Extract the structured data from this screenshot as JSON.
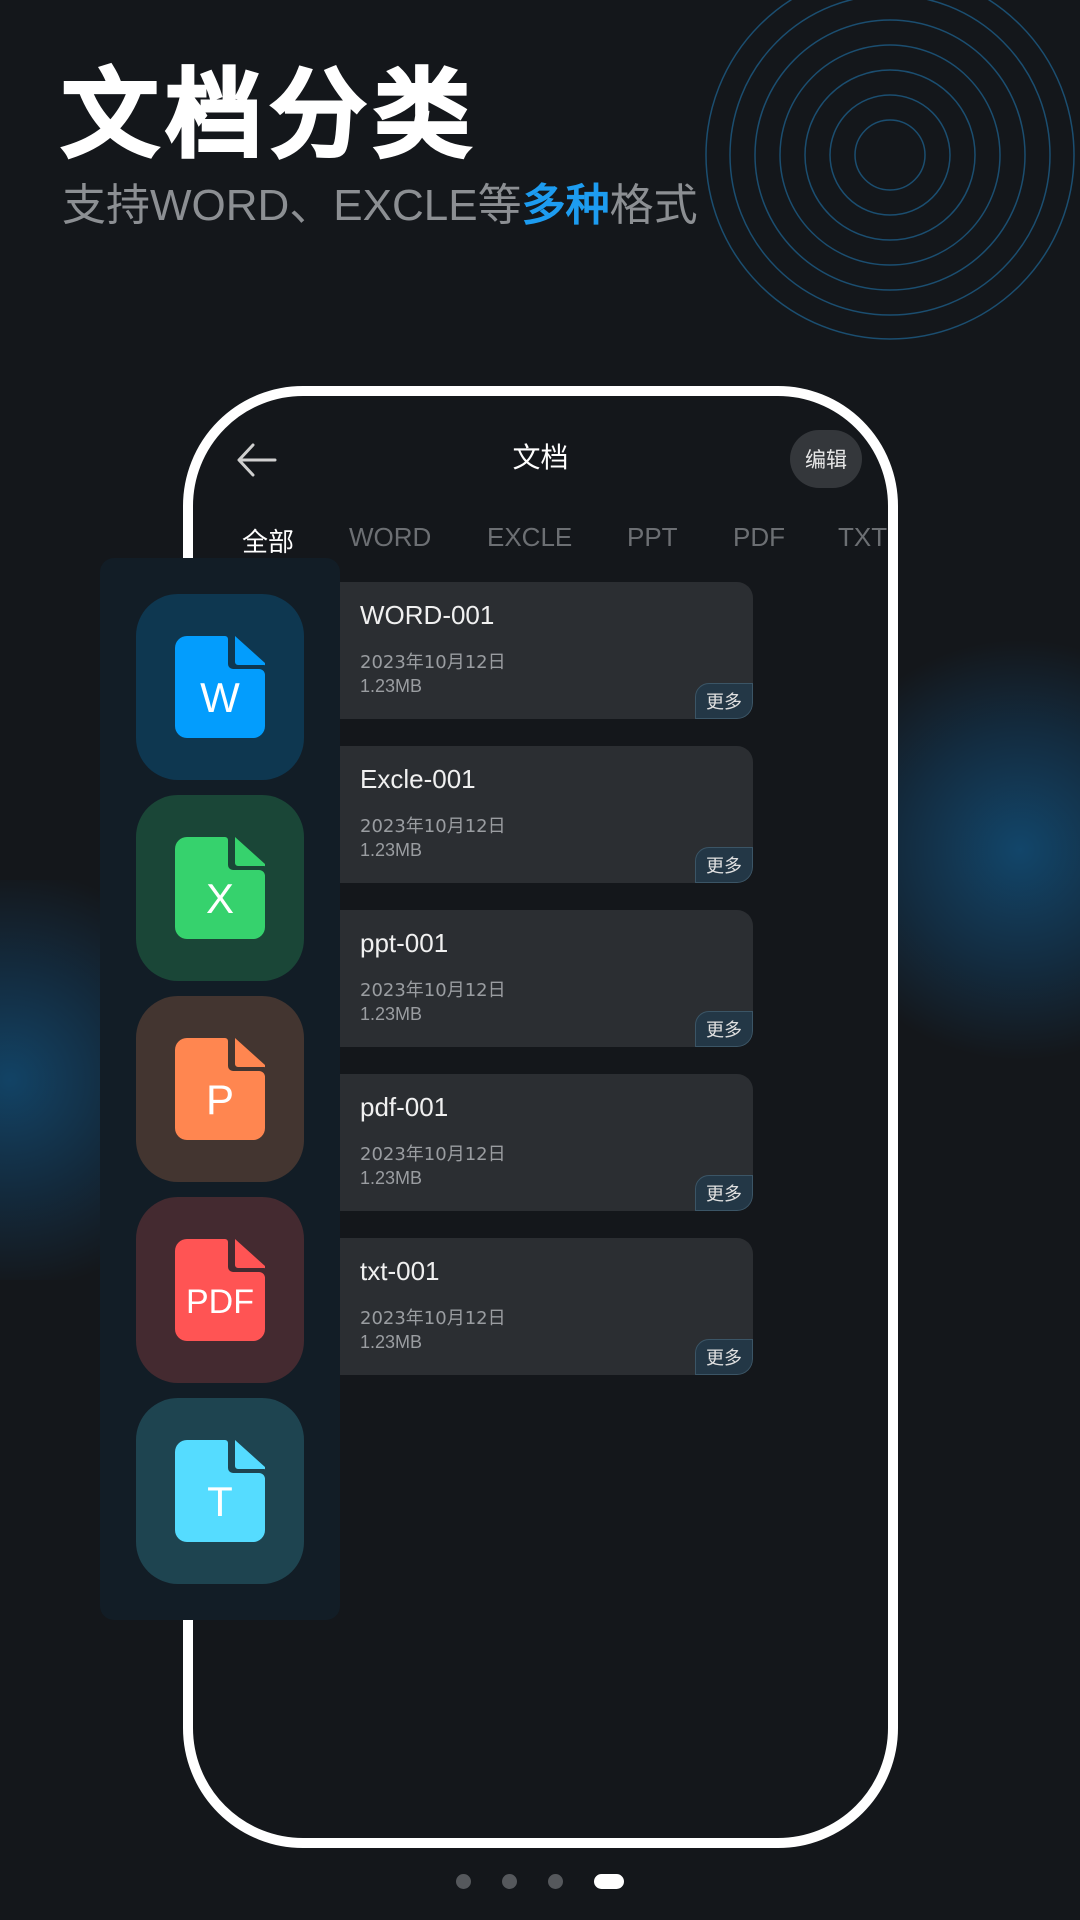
{
  "hero": {
    "title": "文档分类",
    "subtitle_pre": "支持WORD、EXCLE等",
    "subtitle_highlight": "多种",
    "subtitle_post": "格式"
  },
  "colors": {
    "accent": "#1d9cf0",
    "background": "#14171b",
    "word": "#039dfd",
    "excel": "#36d26d",
    "ppt": "#ff8650",
    "pdf": "#ff5454",
    "txt": "#55dcff"
  },
  "app": {
    "back_icon": "arrow-left-icon",
    "title": "文档",
    "edit_label": "编辑",
    "tabs": [
      {
        "label": "全部",
        "active": true
      },
      {
        "label": "WORD"
      },
      {
        "label": "EXCLE"
      },
      {
        "label": "PPT"
      },
      {
        "label": "PDF"
      },
      {
        "label": "TXT"
      }
    ],
    "files": [
      {
        "name": "WORD-001",
        "date": "2023年10月12日",
        "size": "1.23MB",
        "more": "更多"
      },
      {
        "name": "Excle-001",
        "date": "2023年10月12日",
        "size": "1.23MB",
        "more": "更多"
      },
      {
        "name": "ppt-001",
        "date": "2023年10月12日",
        "size": "1.23MB",
        "more": "更多"
      },
      {
        "name": "pdf-001",
        "date": "2023年10月12日",
        "size": "1.23MB",
        "more": "更多"
      },
      {
        "name": "txt-001",
        "date": "2023年10月12日",
        "size": "1.23MB",
        "more": "更多"
      }
    ]
  },
  "file_types": [
    {
      "letter": "W",
      "icon": "word-file-icon"
    },
    {
      "letter": "X",
      "icon": "excel-file-icon"
    },
    {
      "letter": "P",
      "icon": "ppt-file-icon"
    },
    {
      "letter": "PDF",
      "icon": "pdf-file-icon"
    },
    {
      "letter": "T",
      "icon": "txt-file-icon"
    }
  ],
  "pagination": {
    "total": 4,
    "current": 4
  }
}
